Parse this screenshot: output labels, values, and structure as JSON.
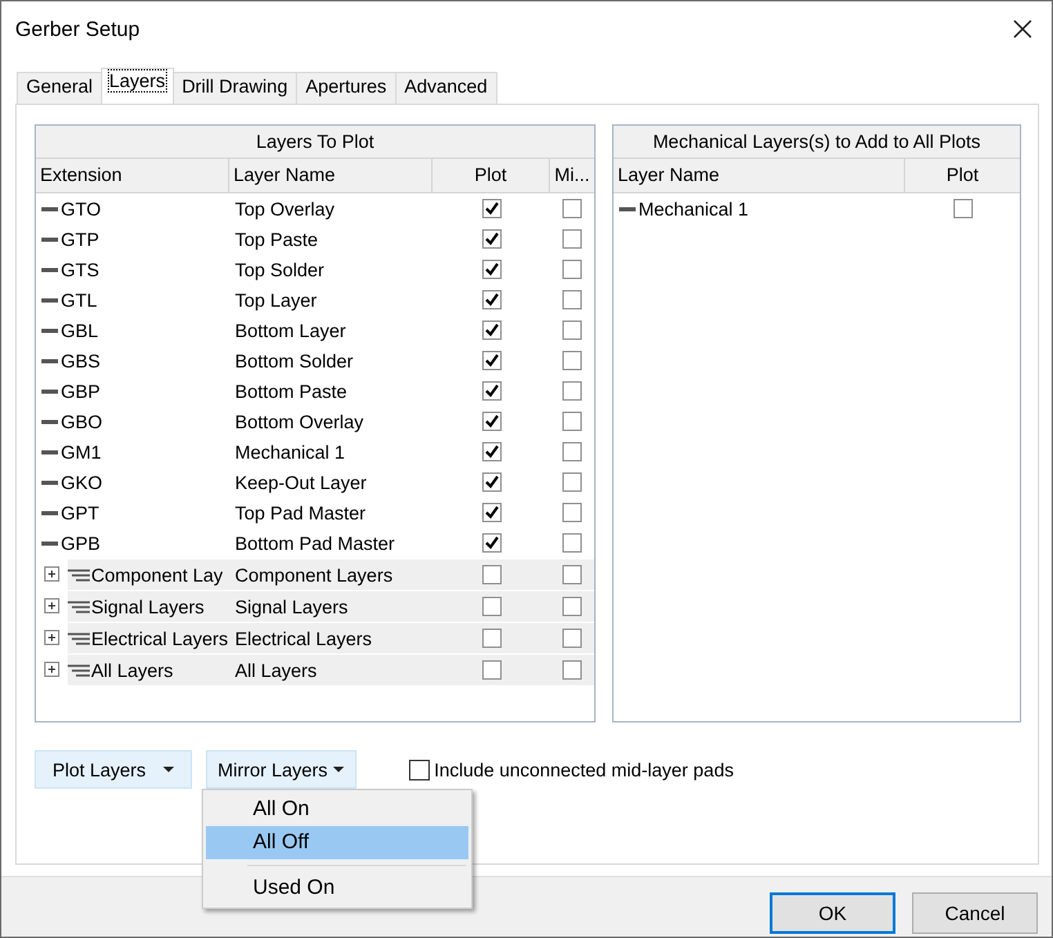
{
  "window": {
    "title": "Gerber Setup"
  },
  "tabs": [
    {
      "label": "General",
      "selected": false
    },
    {
      "label": "Layers",
      "selected": true
    },
    {
      "label": "Drill Drawing",
      "selected": false
    },
    {
      "label": "Apertures",
      "selected": false
    },
    {
      "label": "Advanced",
      "selected": false
    }
  ],
  "layers_table": {
    "title": "Layers To Plot",
    "columns": [
      "Extension",
      "Layer Name",
      "Plot",
      "Mi..."
    ],
    "rows": [
      {
        "kind": "layer",
        "extension": "GTO",
        "layer_name": "Top Overlay",
        "plot": true,
        "mirror": false
      },
      {
        "kind": "layer",
        "extension": "GTP",
        "layer_name": "Top Paste",
        "plot": true,
        "mirror": false
      },
      {
        "kind": "layer",
        "extension": "GTS",
        "layer_name": "Top Solder",
        "plot": true,
        "mirror": false
      },
      {
        "kind": "layer",
        "extension": "GTL",
        "layer_name": "Top Layer",
        "plot": true,
        "mirror": false
      },
      {
        "kind": "layer",
        "extension": "GBL",
        "layer_name": "Bottom Layer",
        "plot": true,
        "mirror": false
      },
      {
        "kind": "layer",
        "extension": "GBS",
        "layer_name": "Bottom Solder",
        "plot": true,
        "mirror": false
      },
      {
        "kind": "layer",
        "extension": "GBP",
        "layer_name": "Bottom Paste",
        "plot": true,
        "mirror": false
      },
      {
        "kind": "layer",
        "extension": "GBO",
        "layer_name": "Bottom Overlay",
        "plot": true,
        "mirror": false
      },
      {
        "kind": "layer",
        "extension": "GM1",
        "layer_name": "Mechanical 1",
        "plot": true,
        "mirror": false
      },
      {
        "kind": "layer",
        "extension": "GKO",
        "layer_name": "Keep-Out Layer",
        "plot": true,
        "mirror": false
      },
      {
        "kind": "layer",
        "extension": "GPT",
        "layer_name": "Top Pad Master",
        "plot": true,
        "mirror": false
      },
      {
        "kind": "layer",
        "extension": "GPB",
        "layer_name": "Bottom Pad Master",
        "plot": true,
        "mirror": false
      },
      {
        "kind": "group",
        "extension": "Component Lay",
        "layer_name": "Component Layers",
        "plot": false,
        "mirror": false,
        "expanded": false
      },
      {
        "kind": "group",
        "extension": "Signal Layers",
        "layer_name": "Signal Layers",
        "plot": false,
        "mirror": false,
        "expanded": false
      },
      {
        "kind": "group",
        "extension": "Electrical Layers",
        "layer_name": "Electrical Layers",
        "plot": false,
        "mirror": false,
        "expanded": false
      },
      {
        "kind": "group",
        "extension": "All Layers",
        "layer_name": "All Layers",
        "plot": false,
        "mirror": false,
        "expanded": false
      }
    ]
  },
  "mechanical_table": {
    "title": "Mechanical Layers(s) to Add to All Plots",
    "columns": [
      "Layer Name",
      "Plot"
    ],
    "rows": [
      {
        "layer_name": "Mechanical 1",
        "plot": false
      }
    ]
  },
  "plot_layers_button": {
    "label": "Plot Layers"
  },
  "mirror_layers_button": {
    "label": "Mirror Layers"
  },
  "include_unconnected": {
    "label": "Include unconnected mid-layer pads",
    "checked": false
  },
  "mirror_menu": {
    "items": [
      {
        "kind": "item",
        "label": "All On",
        "selected": false
      },
      {
        "kind": "item",
        "label": "All Off",
        "selected": true
      },
      {
        "kind": "separator"
      },
      {
        "kind": "item",
        "label": "Used On",
        "selected": false
      }
    ]
  },
  "buttons": [
    {
      "label": "OK",
      "default": true
    },
    {
      "label": "Cancel",
      "default": false
    }
  ]
}
